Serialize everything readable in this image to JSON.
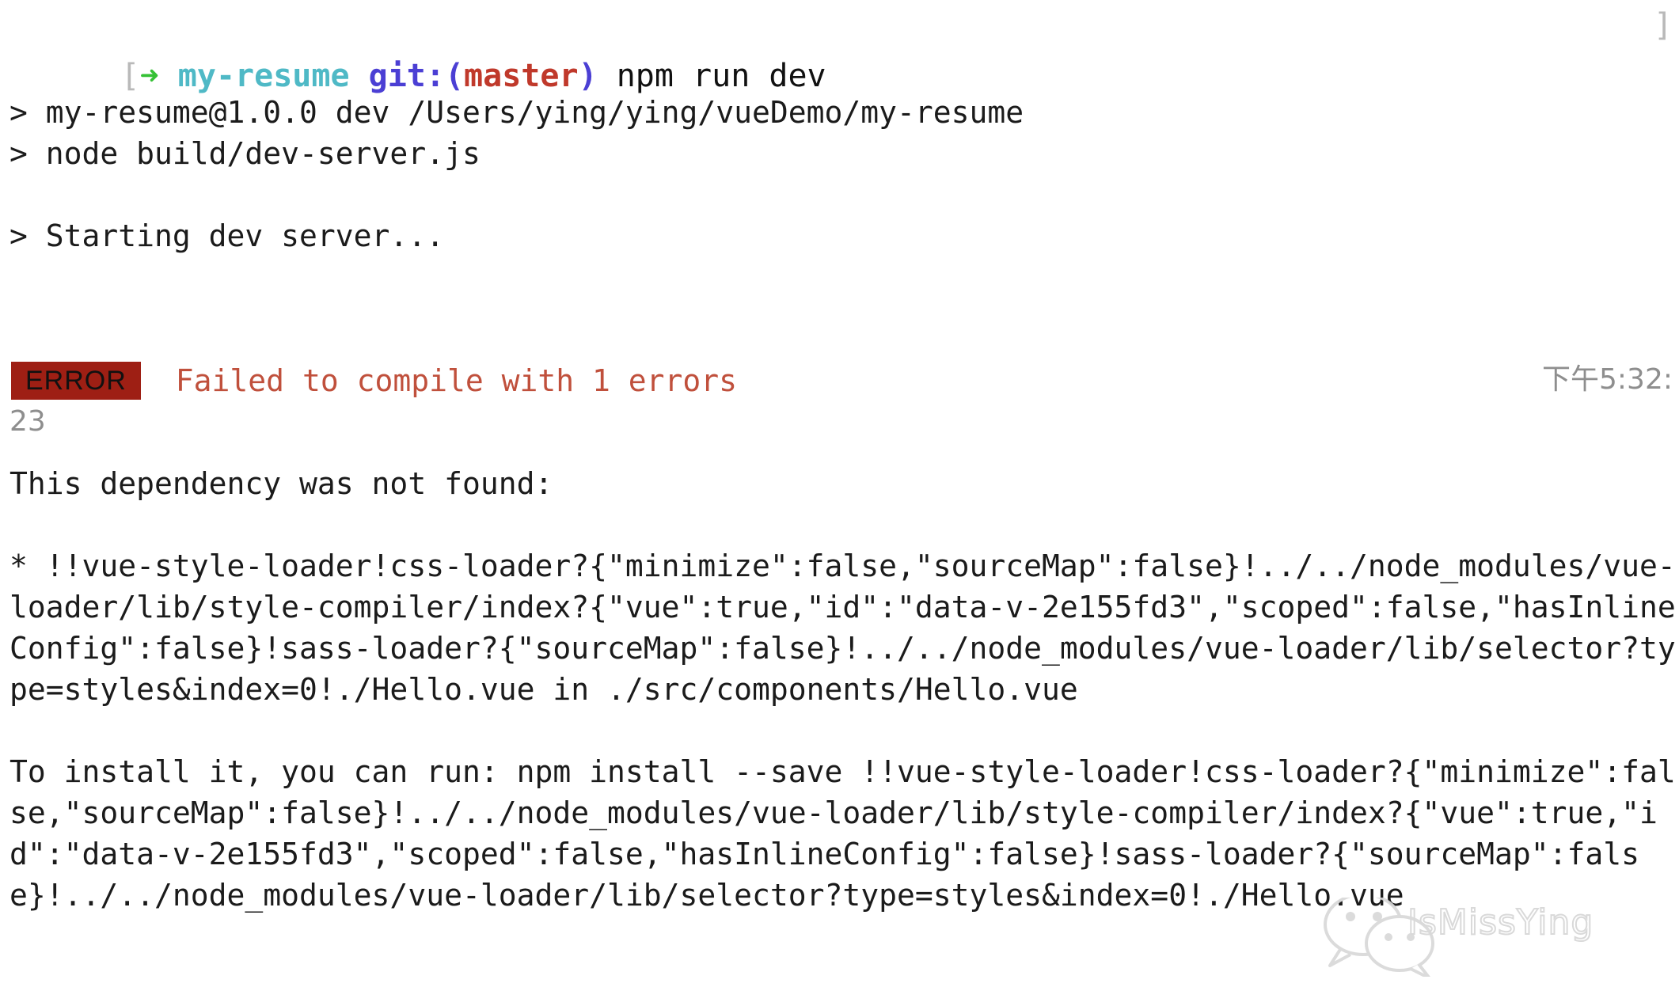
{
  "terminal": {
    "prompt": {
      "open_bracket": "[",
      "arrow_icon": "➜",
      "repo": "my-resume",
      "git_keyword": "git:(",
      "branch": "master",
      "git_close": ")",
      "command": " npm run dev",
      "close_bracket": "]"
    },
    "output_lines": [
      "> my-resume@1.0.0 dev /Users/ying/ying/vueDemo/my-resume",
      "> node build/dev-server.js"
    ],
    "starting_line": "> Starting dev server...",
    "error": {
      "badge": "ERROR",
      "message": "Failed to compile with 1 errors",
      "timestamp": "下午5:32:",
      "timestamp_wrap": "23",
      "badge_color": "#9e1f14",
      "message_color": "#c0503c",
      "timestamp_color": "#8e8e8e"
    },
    "dependency_heading": "This dependency was not found:",
    "dependency_detail": "* !!vue-style-loader!css-loader?{\"minimize\":false,\"sourceMap\":false}!../../node_modules/vue-loader/lib/style-compiler/index?{\"vue\":true,\"id\":\"data-v-2e155fd3\",\"scoped\":false,\"hasInlineConfig\":false}!sass-loader?{\"sourceMap\":false}!../../node_modules/vue-loader/lib/selector?type=styles&index=0!./Hello.vue in ./src/components/Hello.vue",
    "install_hint": "To install it, you can run: npm install --save !!vue-style-loader!css-loader?{\"minimize\":false,\"sourceMap\":false}!../../node_modules/vue-loader/lib/style-compiler/index?{\"vue\":true,\"id\":\"data-v-2e155fd3\",\"scoped\":false,\"hasInlineConfig\":false}!sass-loader?{\"sourceMap\":false}!../../node_modules/vue-loader/lib/selector?type=styles&index=0!./Hello.vue"
  },
  "watermark": {
    "label": "IsMissYing",
    "icon": "wechat-bubble-icon"
  }
}
